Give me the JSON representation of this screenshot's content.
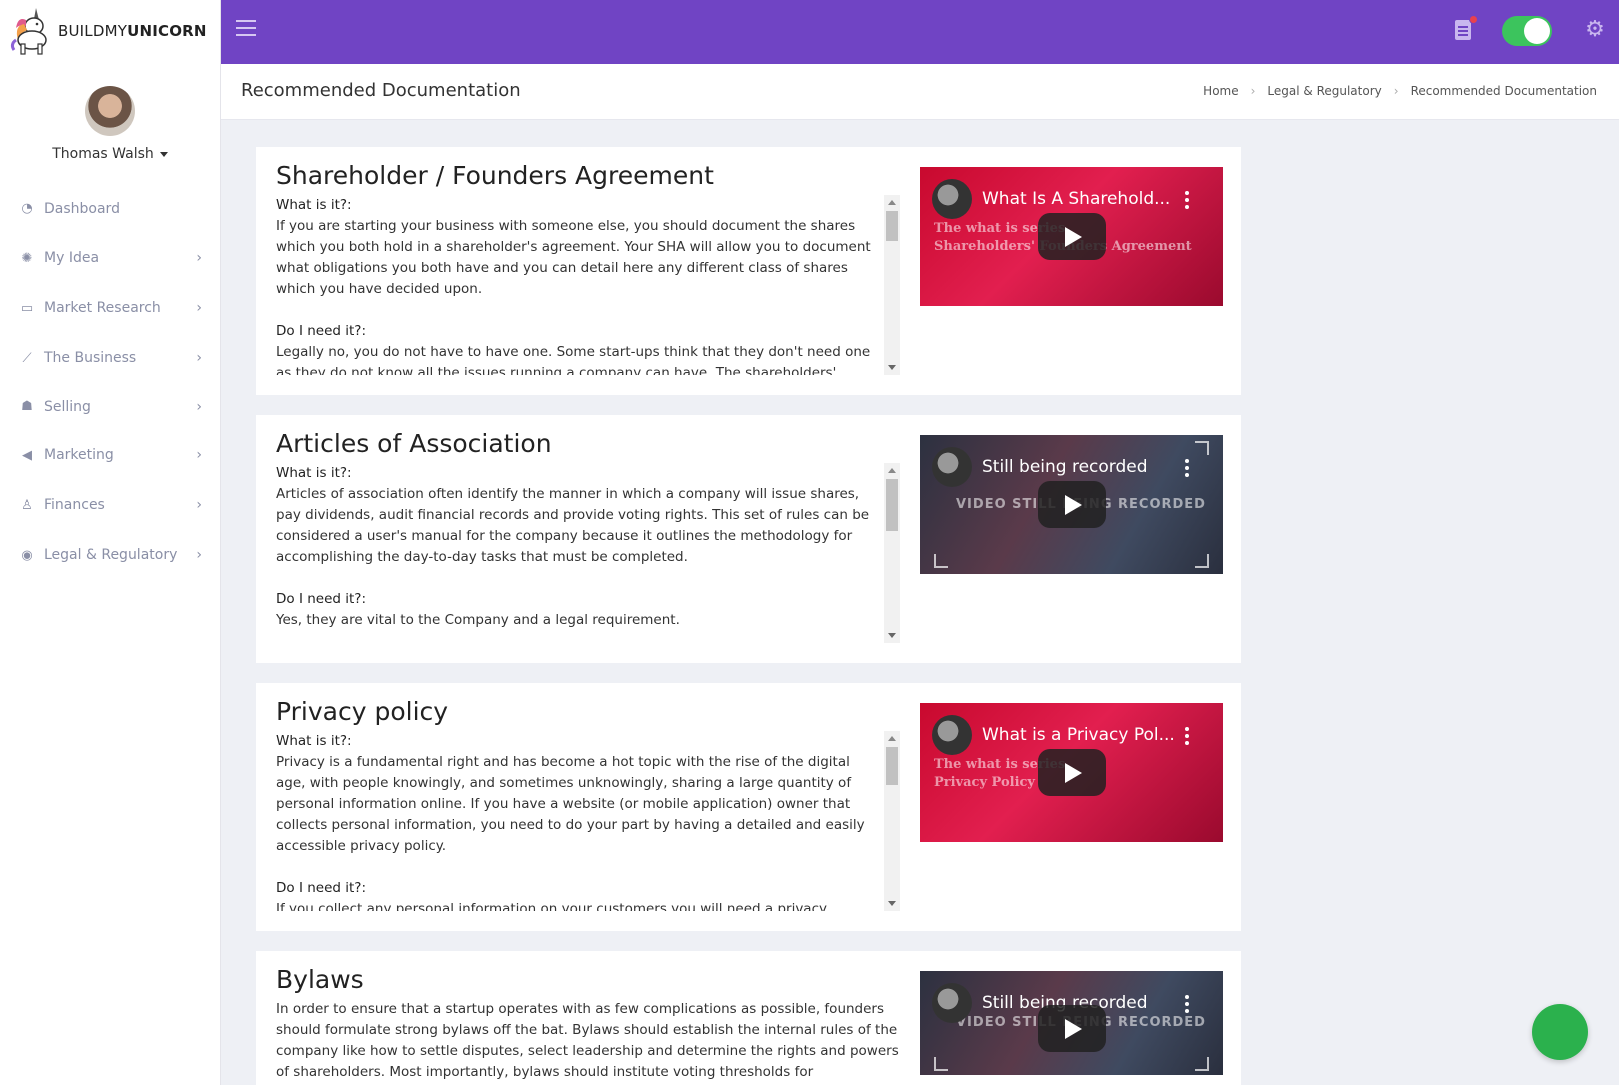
{
  "brand": {
    "name_prefix": "BUILDMY",
    "name_suffix": "UNICORN"
  },
  "user": {
    "name": "Thomas Walsh"
  },
  "sidebar": {
    "items": [
      {
        "label": "Dashboard",
        "icon": "gauge-icon",
        "has_chevron": false
      },
      {
        "label": "My Idea",
        "icon": "lightbulb-icon",
        "has_chevron": true
      },
      {
        "label": "Market Research",
        "icon": "chat-icon",
        "has_chevron": true
      },
      {
        "label": "The Business",
        "icon": "chart-line-icon",
        "has_chevron": true
      },
      {
        "label": "Selling",
        "icon": "people-icon",
        "has_chevron": true
      },
      {
        "label": "Marketing",
        "icon": "megaphone-icon",
        "has_chevron": true
      },
      {
        "label": "Finances",
        "icon": "flask-icon",
        "has_chevron": true
      },
      {
        "label": "Legal & Regulatory",
        "icon": "location-pin-icon",
        "has_chevron": true
      }
    ]
  },
  "topbar": {
    "color": "#7044c4",
    "toggle_on": true,
    "toggle_color": "#3cc45d"
  },
  "page": {
    "title": "Recommended Documentation",
    "breadcrumb": [
      "Home",
      "Legal & Regulatory",
      "Recommended Documentation"
    ]
  },
  "cards": [
    {
      "title": "Shareholder / Founders Agreement",
      "what_label": "What is it?:",
      "what_text": "If you are starting your business with someone else, you should document the shares which you both hold in a shareholder's agreement. Your SHA will allow you to document what obligations you both have and you can detail here any different class of shares which you have decided upon.",
      "need_label": "Do I need it?:",
      "need_text": "Legally no, you do not have to have one. Some start-ups think that they don't need one as they do not know all the issues running a company can have. The shareholders'",
      "video_title": "What Is A Sharehold...",
      "video_overlay_1": "The what is series",
      "video_overlay_2": "Shareholders' Founders Agreement",
      "video_style": "red"
    },
    {
      "title": "Articles of Association",
      "what_label": "What is it?:",
      "what_text": "Articles of association often identify the manner in which a company will issue shares, pay dividends, audit financial records and provide voting rights. This set of rules can be considered a user's manual for the company because it outlines the methodology for accomplishing the day-to-day tasks that must be completed.",
      "need_label": "Do I need it?:",
      "need_text": "Yes, they are vital to the Company and a legal requirement.",
      "video_title": "Still being recorded",
      "video_overlay_1": "VIDEO STILL BEING RECORDED",
      "video_overlay_2": "",
      "video_style": "dark"
    },
    {
      "title": "Privacy policy",
      "what_label": "What is it?:",
      "what_text": "Privacy is a fundamental right and has become a hot topic with the rise of the digital age, with people knowingly, and sometimes unknowingly, sharing a large quantity of personal information online.   If you have a website (or mobile application) owner that collects personal information, you need to do your part by having a detailed and easily accessible privacy policy.",
      "need_label": "Do I need it?:",
      "need_text": "If you collect any personal information on your customers you will need a privacy",
      "video_title": "What is a Privacy Pol...",
      "video_overlay_1": "The what is series",
      "video_overlay_2": "Privacy Policy",
      "video_style": "red"
    },
    {
      "title": "Bylaws",
      "body_text": "In order to ensure that a startup operates with as few complications as possible, founders should formulate strong bylaws off the bat. Bylaws should establish the internal rules of the company like how to settle disputes, select leadership and determine the rights and powers of shareholders. Most importantly, bylaws should institute voting thresholds for",
      "video_title": "Still being recorded",
      "video_overlay_1": "VIDEO STILL BEING RECORDED",
      "video_overlay_2": "",
      "video_style": "dark"
    }
  ]
}
